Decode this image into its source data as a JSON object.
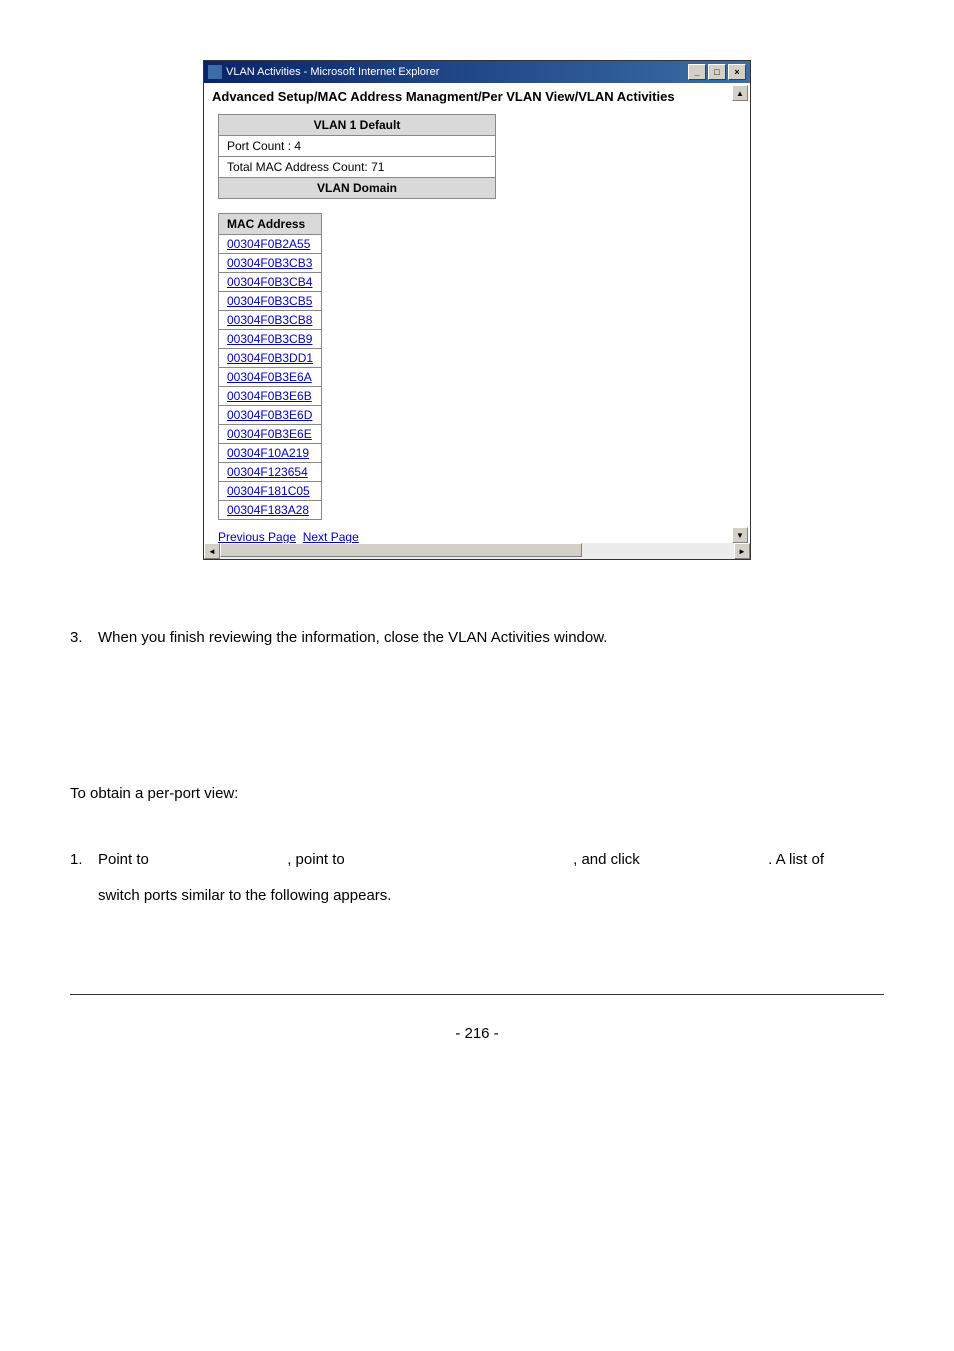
{
  "window": {
    "title": "VLAN Activities - Microsoft Internet Explorer",
    "heading": "Advanced Setup/MAC Address Managment/Per VLAN View/VLAN Activities",
    "info": {
      "vlan_header": "VLAN 1 Default",
      "port_count": "Port Count : 4",
      "mac_count": "Total MAC Address Count: 71",
      "domain_header": "VLAN Domain"
    },
    "mac_header": "MAC Address",
    "mac_list": [
      "00304F0B2A55",
      "00304F0B3CB3",
      "00304F0B3CB4",
      "00304F0B3CB5",
      "00304F0B3CB8",
      "00304F0B3CB9",
      "00304F0B3DD1",
      "00304F0B3E6A",
      "00304F0B3E6B",
      "00304F0B3E6D",
      "00304F0B3E6E",
      "00304F10A219",
      "00304F123654",
      "00304F181C05",
      "00304F183A28"
    ],
    "prev_page": "Previous Page",
    "next_page": "Next Page"
  },
  "body": {
    "step3_num": "3.",
    "step3_text": "When you finish reviewing the information, close the VLAN Activities window.",
    "subsection_intro": "To obtain a per-port view:",
    "step1_num": "1.",
    "step1_part1": "Point to ",
    "step1_part2": ", point to ",
    "step1_part3": ", and click ",
    "step1_part4": ". A list of",
    "step1_line2": "switch ports similar to the following appears."
  },
  "footer": {
    "page_num": "- 216 -"
  }
}
